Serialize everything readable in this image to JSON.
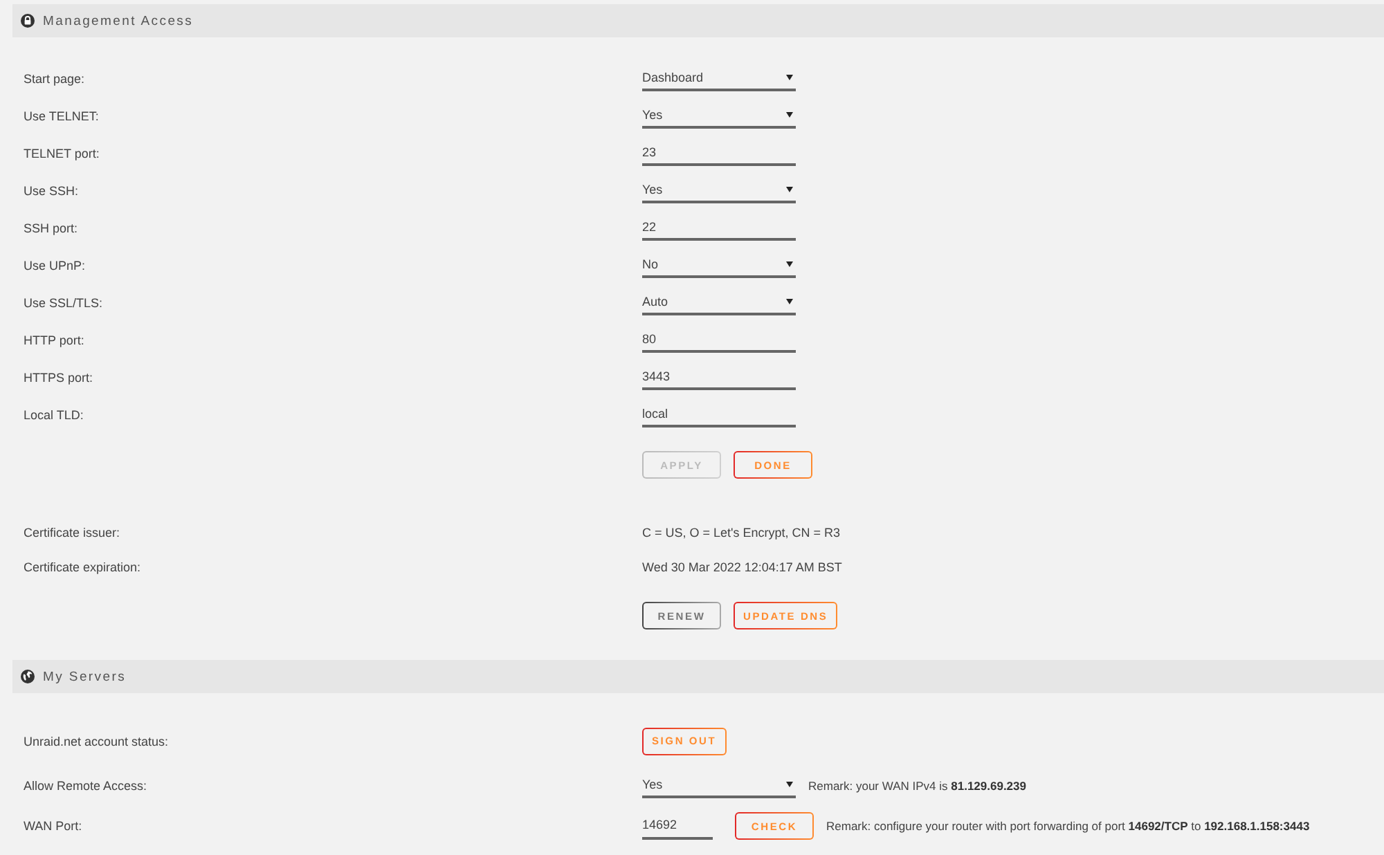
{
  "sections": [
    {
      "title": "Management Access",
      "rows": [
        {
          "label": "Start page:",
          "controls": [
            {
              "kind": "select",
              "value": "Dashboard"
            }
          ]
        },
        {
          "label": "Use TELNET:",
          "controls": [
            {
              "kind": "select",
              "value": "Yes"
            }
          ]
        },
        {
          "label": "TELNET port:",
          "controls": [
            {
              "kind": "input",
              "value": "23"
            }
          ]
        },
        {
          "label": "Use SSH:",
          "controls": [
            {
              "kind": "select",
              "value": "Yes"
            }
          ]
        },
        {
          "label": "SSH port:",
          "controls": [
            {
              "kind": "input",
              "value": "22"
            }
          ]
        },
        {
          "label": "Use UPnP:",
          "controls": [
            {
              "kind": "select",
              "value": "No"
            }
          ]
        },
        {
          "label": "Use SSL/TLS:",
          "controls": [
            {
              "kind": "select",
              "value": "Auto"
            }
          ]
        },
        {
          "label": "HTTP port:",
          "controls": [
            {
              "kind": "input",
              "value": "80"
            }
          ]
        },
        {
          "label": "HTTPS port:",
          "controls": [
            {
              "kind": "input",
              "value": "3443"
            }
          ]
        },
        {
          "label": "Local TLD:",
          "controls": [
            {
              "kind": "input",
              "value": "local"
            }
          ]
        },
        {
          "controls": [
            {
              "kind": "button",
              "label": "APPLY",
              "accent": false,
              "disabled": true
            },
            {
              "kind": "button",
              "label": "DONE",
              "accent": true,
              "disabled": false
            }
          ]
        },
        {
          "label": "Certificate issuer:",
          "controls": [
            {
              "kind": "text",
              "value": "C = US, O = Let's Encrypt, CN = R3"
            }
          ]
        },
        {
          "label": "Certificate expiration:",
          "controls": [
            {
              "kind": "text",
              "value": "Wed 30 Mar 2022 12:04:17 AM BST"
            }
          ]
        },
        {
          "controls": [
            {
              "kind": "button",
              "label": "RENEW",
              "accent": false,
              "disabled": false
            },
            {
              "kind": "button",
              "label": "UPDATE DNS",
              "accent": true,
              "disabled": false
            }
          ]
        }
      ]
    },
    {
      "title": "My Servers",
      "rows": [
        {
          "label": "Unraid.net account status:",
          "controls": [
            {
              "kind": "button",
              "label": "SIGN OUT",
              "accent": true,
              "disabled": false
            }
          ]
        },
        {
          "label": "Allow Remote Access:",
          "controls": [
            {
              "kind": "select",
              "value": "Yes"
            },
            {
              "kind": "remark",
              "text": "Remark: your WAN IPv4 is **81.129.69.239**"
            }
          ]
        },
        {
          "label": "WAN Port:",
          "controls": [
            {
              "kind": "input",
              "value": "14692"
            },
            {
              "kind": "button",
              "label": "CHECK",
              "accent": true,
              "disabled": false
            },
            {
              "kind": "remark",
              "text": "Remark: configure your router with port forwarding of port **14692/TCP** to **192.168.1.158:3443**"
            }
          ]
        }
      ]
    }
  ]
}
